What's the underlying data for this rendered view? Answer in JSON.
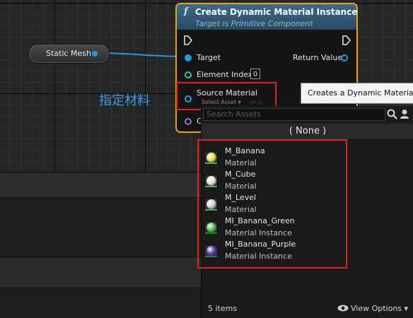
{
  "static_mesh": {
    "label": "Static Mesh"
  },
  "node": {
    "icon": "function-icon",
    "title": "Create Dynamic Material Instance",
    "subtitle": "Target is Primitive Component",
    "pins": {
      "target": "Target",
      "return_value": "Return Value",
      "element_index": "Element Index",
      "element_index_value": "0",
      "source_material": "Source Material",
      "select_asset": "Select Asset",
      "truncated_pin": "C"
    }
  },
  "annotation": {
    "text": "指定材料"
  },
  "tooltip": {
    "text": "Creates a Dynamic Material"
  },
  "picker": {
    "search_placeholder": "Search Assets",
    "none_label": "( None )",
    "assets": [
      {
        "name": "M_Banana",
        "type": "Material",
        "color": "#e4e05a",
        "bar": "#4caf50"
      },
      {
        "name": "M_Cube",
        "type": "Material",
        "color": "#e0e0e0",
        "bar": "#4caf50"
      },
      {
        "name": "M_Level",
        "type": "Material",
        "color": "#d0d0d0",
        "bar": "#4caf50"
      },
      {
        "name": "MI_Banana_Green",
        "type": "Material Instance",
        "color": "#4ec24e",
        "bar": "#2e7d32"
      },
      {
        "name": "MI_Banana_Purple",
        "type": "Material Instance",
        "color": "#6a3cc8",
        "bar": "#2e7d32"
      }
    ],
    "count": "5 items",
    "view_options": "View Options"
  },
  "colors": {
    "node_border": "#e8a317",
    "object_pin": "#1e9ede",
    "int_pin": "#2ec9a0",
    "material_pin": "#1e9ede",
    "purple_pin": "#a06ad8",
    "highlight_box": "#e02020",
    "annotation": "#3f9be6"
  }
}
